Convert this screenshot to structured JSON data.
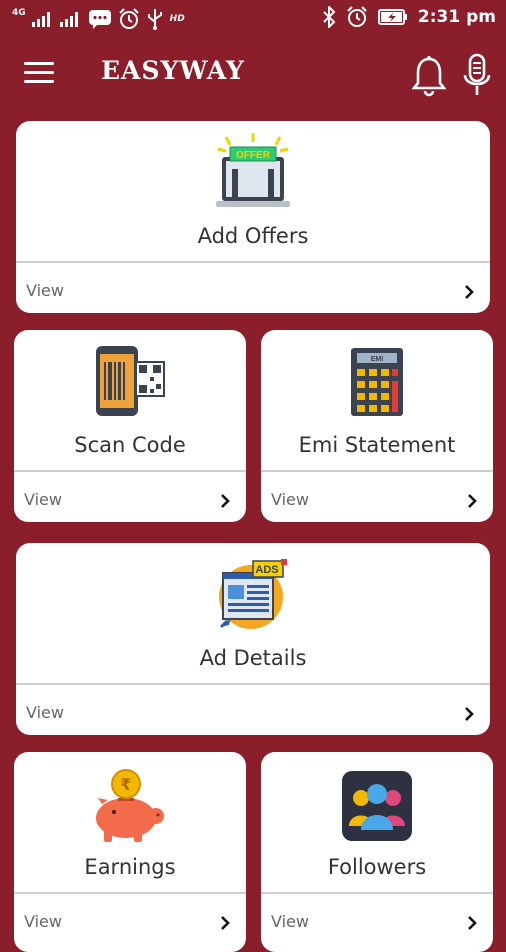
{
  "status_bar": {
    "network_label": "4G",
    "hd_label": "HD",
    "time": "2:31 pm"
  },
  "app_bar": {
    "title": "EASYWAY"
  },
  "cards": [
    {
      "title": "Add Offers",
      "view": "View",
      "icon": "offer-laptop-icon"
    },
    {
      "title": "Scan Code",
      "view": "View",
      "icon": "qr-scanner-phone-icon"
    },
    {
      "title": "Emi Statement",
      "view": "View",
      "icon": "calculator-icon"
    },
    {
      "title": "Ad Details",
      "view": "View",
      "icon": "ads-newspaper-icon"
    },
    {
      "title": "Earnings",
      "view": "View",
      "icon": "piggy-bank-icon"
    },
    {
      "title": "Followers",
      "view": "View",
      "icon": "people-group-icon"
    }
  ],
  "icon_text": {
    "offer_sign": "OFFER",
    "emi_display": "EMI",
    "ads_badge": "ADS",
    "rupee_symbol": "₹"
  },
  "colors": {
    "background": "#8b1e2b",
    "card": "#ffffff",
    "divider": "#cfcfcf"
  }
}
